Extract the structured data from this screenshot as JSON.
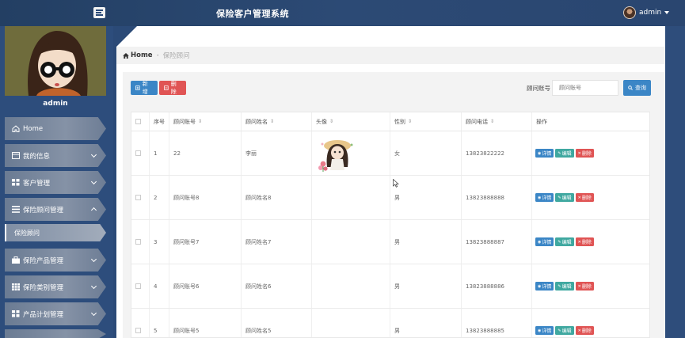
{
  "app": {
    "title": "保险客户管理系统"
  },
  "user": {
    "name": "admin"
  },
  "sidebar": {
    "profile_name": "admin",
    "items": [
      {
        "label": "Home",
        "icon": "home-icon"
      },
      {
        "label": "我的信息",
        "icon": "window-icon"
      },
      {
        "label": "客户管理",
        "icon": "grid-icon"
      },
      {
        "label": "保险顾问管理",
        "icon": "list-icon",
        "expanded": true
      },
      {
        "label": "保险产品管理",
        "icon": "briefcase-icon"
      },
      {
        "label": "保险类别管理",
        "icon": "grid9-icon"
      },
      {
        "label": "产品计划管理",
        "icon": "grid-icon"
      }
    ],
    "sub_item": "保险顾问"
  },
  "breadcrumb": {
    "home": "Home",
    "sep": "-",
    "current": "保险顾问"
  },
  "toolbar": {
    "add_label": "新增",
    "delete_label": "删除",
    "search_label": "顾问账号",
    "search_placeholder": "顾问账号",
    "search_button": "查询"
  },
  "table": {
    "columns": [
      "序号",
      "顾问账号",
      "顾问姓名",
      "头像",
      "性别",
      "顾问电话",
      "操作"
    ],
    "rows": [
      {
        "no": "1",
        "account": "22",
        "name": "李丽",
        "gender": "女",
        "phone": "13823822222",
        "has_avatar": true
      },
      {
        "no": "2",
        "account": "顾问账号8",
        "name": "顾问姓名8",
        "gender": "男",
        "phone": "13823888888",
        "has_avatar": false
      },
      {
        "no": "3",
        "account": "顾问账号7",
        "name": "顾问姓名7",
        "gender": "男",
        "phone": "13823888887",
        "has_avatar": false
      },
      {
        "no": "4",
        "account": "顾问账号6",
        "name": "顾问姓名6",
        "gender": "男",
        "phone": "13823888886",
        "has_avatar": false
      },
      {
        "no": "5",
        "account": "顾问账号5",
        "name": "顾问姓名5",
        "gender": "男",
        "phone": "13823888885",
        "has_avatar": false
      }
    ],
    "actions": {
      "view": "详情",
      "edit": "编辑",
      "delete": "删除"
    }
  },
  "colors": {
    "primary": "#3b86c6",
    "danger": "#e05454",
    "teal": "#3fa8a0",
    "nav_bg": "#2b4a77"
  }
}
